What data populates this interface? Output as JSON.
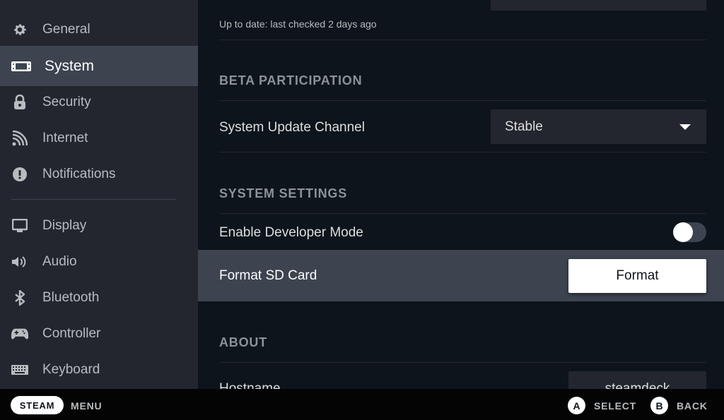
{
  "sidebar": {
    "items": [
      {
        "label": "General",
        "icon": "gear-icon",
        "active": false
      },
      {
        "label": "System",
        "icon": "handheld-device-icon",
        "active": true
      },
      {
        "label": "Security",
        "icon": "lock-icon",
        "active": false
      },
      {
        "label": "Internet",
        "icon": "wifi-signal-icon",
        "active": false
      },
      {
        "label": "Notifications",
        "icon": "alert-icon",
        "active": false
      },
      {
        "label": "Display",
        "icon": "monitor-icon",
        "active": false
      },
      {
        "label": "Audio",
        "icon": "speaker-icon",
        "active": false
      },
      {
        "label": "Bluetooth",
        "icon": "bluetooth-icon",
        "active": false
      },
      {
        "label": "Controller",
        "icon": "gamepad-icon",
        "active": false
      },
      {
        "label": "Keyboard",
        "icon": "keyboard-icon",
        "active": false
      }
    ]
  },
  "main": {
    "update_status": "Up to date: last checked 2 days ago",
    "beta": {
      "heading": "BETA PARTICIPATION",
      "channel_label": "System Update Channel",
      "channel_value": "Stable"
    },
    "system_settings": {
      "heading": "SYSTEM SETTINGS",
      "dev_mode_label": "Enable Developer Mode",
      "dev_mode_enabled": false,
      "format_label": "Format SD Card",
      "format_button": "Format"
    },
    "about": {
      "heading": "ABOUT",
      "hostname_label": "Hostname",
      "hostname_value": "steamdeck"
    }
  },
  "footer": {
    "steam": "STEAM",
    "menu": "MENU",
    "a_glyph": "A",
    "select": "SELECT",
    "b_glyph": "B",
    "back": "BACK"
  },
  "colors": {
    "background": "#0e141b",
    "sidebar": "#23262e",
    "active": "#3d4450",
    "text": "#dcdedf",
    "muted": "#8b929a"
  }
}
